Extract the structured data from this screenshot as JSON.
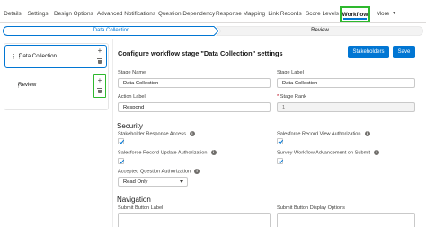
{
  "tabs": [
    {
      "label": "Details"
    },
    {
      "label": "Settings"
    },
    {
      "label": "Design Options"
    },
    {
      "label": "Advanced Notifications"
    },
    {
      "label": "Question Dependency"
    },
    {
      "label": "Response Mapping"
    },
    {
      "label": "Link Records"
    },
    {
      "label": "Score Levels"
    },
    {
      "label": "Workflow"
    },
    {
      "label": "More"
    }
  ],
  "path": {
    "steps": [
      {
        "label": "Data Collection",
        "state": "current"
      },
      {
        "label": "Review",
        "state": "incomplete"
      }
    ]
  },
  "stages": [
    {
      "name": "Data Collection",
      "selected": true
    },
    {
      "name": "Review",
      "selected": false
    }
  ],
  "panel": {
    "title": "Configure workflow stage \"Data Collection\" settings",
    "stakeholders_label": "Stakeholders",
    "save_label": "Save",
    "stage_name_label": "Stage Name",
    "stage_name_value": "Data Collection",
    "stage_label_label": "Stage Label",
    "stage_label_value": "Data Collection",
    "action_label_label": "Action Label",
    "action_label_value": "Respond",
    "stage_rank_label": "Stage Rank",
    "stage_rank_required": "*",
    "stage_rank_value": "1",
    "security_heading": "Security",
    "stakeholder_access_label": "Stakeholder Response Access",
    "sf_view_auth_label": "Salesforce Record View Authorization",
    "sf_update_auth_label": "Salesforce Record Update Authorization",
    "survey_advance_label": "Survey Workflow Advancement on Submit",
    "accepted_question_auth_label": "Accepted Question Authorization",
    "accepted_question_auth_value": "Read Only",
    "navigation_heading": "Navigation",
    "submit_button_label_label": "Submit Button Label",
    "submit_button_display_label": "Submit Button Display Options"
  },
  "colors": {
    "brand": "#0176d3",
    "highlight": "#2eb82e"
  }
}
